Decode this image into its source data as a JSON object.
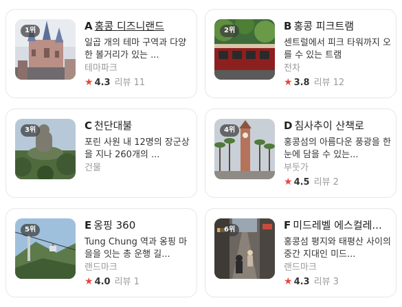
{
  "places": [
    {
      "rank": "1위",
      "letter": "A",
      "name": "홍콩 디즈니랜드",
      "description": "일곱 개의 테마 구역과 다양한 볼거리가 있는 ...",
      "category": "테마파크",
      "rating": "4.3",
      "reviews_label": "리뷰",
      "reviews_count": "11",
      "thumbnail_icon": "disneyland-castle-photo"
    },
    {
      "rank": "2위",
      "letter": "B",
      "name": "홍콩 피크트램",
      "description": "센트럴에서 피크 타워까지 오를 수 있는 트램",
      "category": "전차",
      "rating": "3.8",
      "reviews_label": "리뷰",
      "reviews_count": "12",
      "thumbnail_icon": "peak-tram-photo"
    },
    {
      "rank": "3위",
      "letter": "C",
      "name": "천단대불",
      "description": "포린 사원 내 12명의 장군상을 지나 260개의 ...",
      "category": "건물",
      "rating": "",
      "reviews_label": "",
      "reviews_count": "",
      "thumbnail_icon": "big-buddha-photo"
    },
    {
      "rank": "4위",
      "letter": "D",
      "name": "침사추이 산책로",
      "description": "홍콩섬의 아름다운 풍광을 한눈에 담을 수 있는...",
      "category": "부둣가",
      "rating": "4.5",
      "reviews_label": "리뷰",
      "reviews_count": "2",
      "thumbnail_icon": "clock-tower-photo"
    },
    {
      "rank": "5위",
      "letter": "E",
      "name": "옹핑 360",
      "description": "Tung Chung 역과 옹핑 마을을 잇는 총 운행 길...",
      "category": "랜드마크",
      "rating": "4.0",
      "reviews_label": "리뷰",
      "reviews_count": "1",
      "thumbnail_icon": "cable-car-photo"
    },
    {
      "rank": "6위",
      "letter": "F",
      "name": "미드레벨 에스컬레...",
      "description": "홍콩섬 평지와 태평산 사이의 중간 지대인 미드...",
      "category": "랜드마크",
      "rating": "4.3",
      "reviews_label": "리뷰",
      "reviews_count": "3",
      "thumbnail_icon": "escalator-street-photo"
    }
  ],
  "colors": {
    "star": "#e8453c",
    "category": "#9a9a9a",
    "border": "#e6e6e6"
  }
}
